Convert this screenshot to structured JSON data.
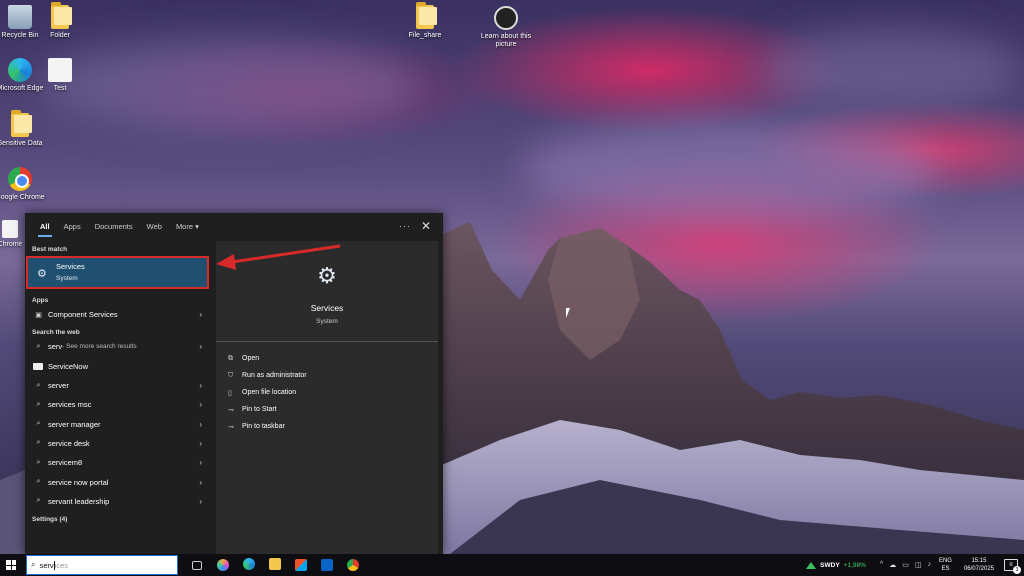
{
  "desktop": {
    "icons": [
      {
        "label": "Recycle Bin",
        "icon": "recycle-bin-icon"
      },
      {
        "label": "Folder",
        "icon": "folder-icon"
      },
      {
        "label": "File_share",
        "icon": "folder-icon"
      },
      {
        "label": "Learn about this picture",
        "icon": "learn-about-picture-icon"
      },
      {
        "label": "Microsoft Edge",
        "icon": "edge-icon"
      },
      {
        "label": "Test",
        "icon": "text-file-icon"
      },
      {
        "label": "Sensitive Data",
        "icon": "folder-icon"
      },
      {
        "label": "Google Chrome",
        "icon": "chrome-icon"
      },
      {
        "label": "Chrome",
        "icon": "chrome-icon"
      }
    ]
  },
  "search_panel": {
    "tabs": [
      "All",
      "Apps",
      "Documents",
      "Web",
      "More"
    ],
    "active_tab": "All",
    "options_glyph": "···",
    "close_glyph": "✕",
    "best_match_header": "Best match",
    "best_match": {
      "title": "Services",
      "subtitle": "System",
      "icon": "gear-icon"
    },
    "apps_header": "Apps",
    "apps": [
      {
        "label": "Component Services",
        "icon": "component-services-icon"
      }
    ],
    "web_header": "Search the web",
    "web_results": [
      {
        "term": "serv",
        "hint": " - See more search results"
      },
      {
        "term": "ServiceNow",
        "hint": ""
      },
      {
        "term": "server",
        "hint": ""
      },
      {
        "term": "services msc",
        "hint": ""
      },
      {
        "term": "server manager",
        "hint": ""
      },
      {
        "term": "service desk",
        "hint": ""
      },
      {
        "term": "servicem8",
        "hint": ""
      },
      {
        "term": "service now portal",
        "hint": ""
      },
      {
        "term": "servant leadership",
        "hint": ""
      }
    ],
    "settings_header": "Settings (4)",
    "preview": {
      "title": "Services",
      "subtitle": "System",
      "actions": [
        {
          "label": "Open",
          "icon": "open-icon"
        },
        {
          "label": "Run as administrator",
          "icon": "shield-icon"
        },
        {
          "label": "Open file location",
          "icon": "file-location-icon"
        },
        {
          "label": "Pin to Start",
          "icon": "pin-icon"
        },
        {
          "label": "Pin to taskbar",
          "icon": "pin-icon"
        }
      ]
    }
  },
  "taskbar": {
    "search": {
      "typed": "serv",
      "suggestion": "ices"
    },
    "apps": [
      "task-view",
      "copilot",
      "edge",
      "file-explorer",
      "microsoft-store",
      "outlook",
      "chrome"
    ],
    "stock": {
      "symbol": "SWDY",
      "change": "+1,98%"
    },
    "language": {
      "line1": "ENG",
      "line2": "ES"
    },
    "clock": {
      "time": "15:15",
      "date": "06/07/2025"
    },
    "notifications": "3"
  },
  "colors": {
    "highlight_border": "#d92a2a",
    "best_match_bg": "#205070",
    "panel_bg": "#1f1f1f",
    "preview_bg": "#2b2b2b",
    "stock_up": "#48d06b"
  }
}
